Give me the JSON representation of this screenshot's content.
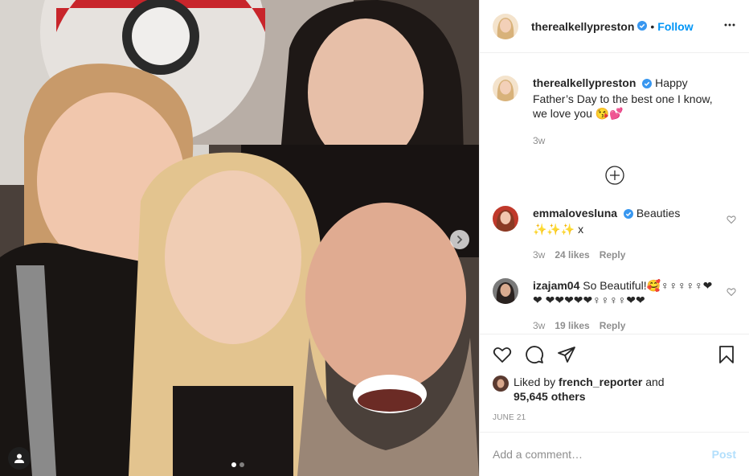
{
  "author": {
    "username": "therealkellypreston",
    "follow_label": "Follow",
    "separator": "•"
  },
  "caption": {
    "username": "therealkellypreston",
    "text": "Happy Father’s Day to the best one I know, we love you 😘💕",
    "age": "3w"
  },
  "comments": [
    {
      "username": "emmalovesluna",
      "text": "Beauties ✨✨✨ x",
      "age": "3w",
      "likes": "24 likes",
      "reply_label": "Reply"
    },
    {
      "username": "izajam04",
      "text": "So Beautiful!🥰♀♀♀♀♀❤❤ ❤❤❤❤❤♀♀♀♀❤❤",
      "age": "3w",
      "likes": "19 likes",
      "reply_label": "Reply"
    }
  ],
  "likes": {
    "prefix": "Liked by",
    "user": "french_reporter",
    "and": "and",
    "others": "95,645 others"
  },
  "date": "JUNE 21",
  "add_comment": {
    "placeholder": "Add a comment…",
    "post_label": "Post"
  },
  "carousel": {
    "current": 1,
    "total": 2
  },
  "colors": {
    "accent": "#0095f6",
    "post_disabled": "#b2dffc",
    "meta": "#8e8e8e"
  },
  "icons": [
    "verified-badge-icon",
    "more-options-icon",
    "load-more-plus-icon",
    "heart-icon",
    "comment-icon",
    "share-icon",
    "bookmark-icon",
    "next-arrow-icon",
    "tag-user-icon"
  ]
}
